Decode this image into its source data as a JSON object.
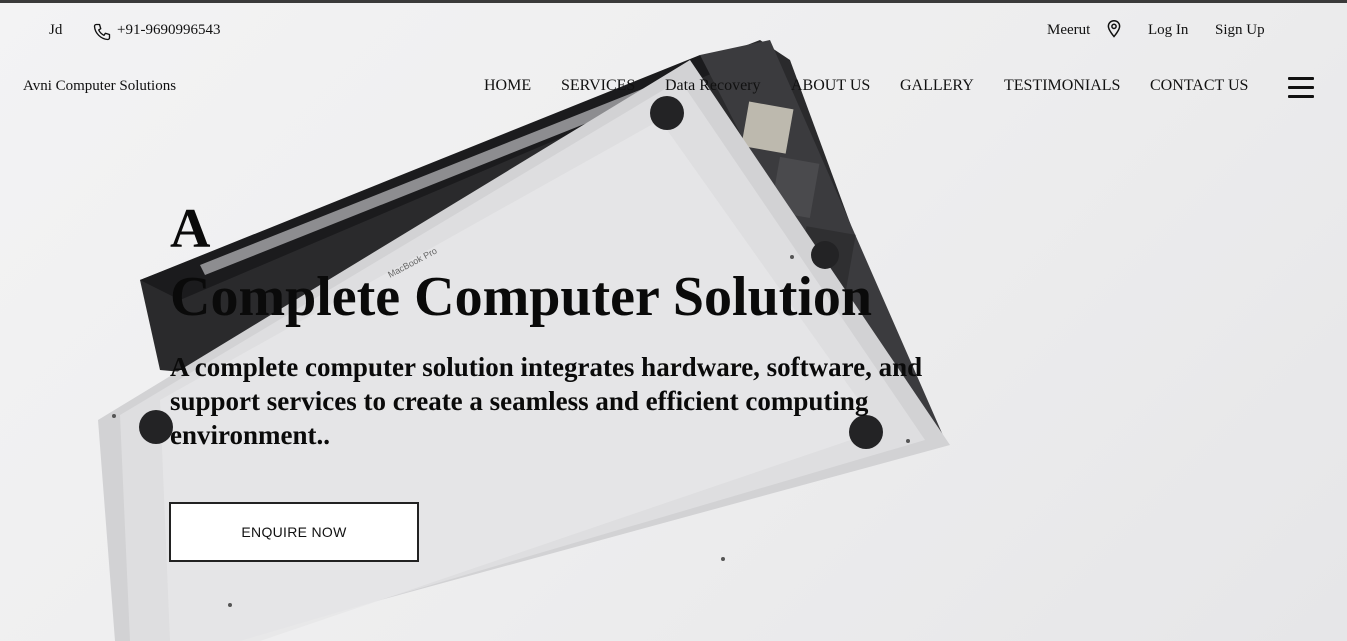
{
  "topbar": {
    "user": "Jd",
    "phone": "+91-9690996543",
    "location": "Meerut",
    "login_label": "Log In",
    "signup_label": "Sign Up"
  },
  "header": {
    "brand": "Avni Computer Solutions",
    "nav": [
      "HOME",
      "SERVICES",
      "Data Recovery",
      "ABOUT US",
      "GALLERY",
      "TESTIMONIALS",
      "CONTACT US"
    ]
  },
  "hero": {
    "title_line1": "A",
    "title_line2": "Complete Computer Solution",
    "subtitle": "A complete computer solution integrates hardware, software, and support services to create a seamless and efficient computing environment..",
    "cta_label": "ENQUIRE NOW",
    "image_text": "MacBook Pro"
  },
  "icons": {
    "phone": "phone-icon",
    "location": "map-pin-icon",
    "menu": "hamburger-menu-icon"
  }
}
